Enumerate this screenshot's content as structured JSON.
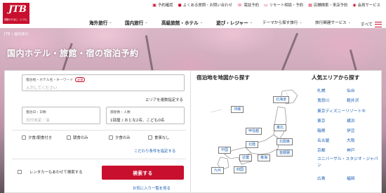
{
  "brand": {
    "logo": "JTB",
    "tagline": "感動のそばに、いつも。"
  },
  "utility": [
    {
      "label": "予約確認",
      "icon": "calendar-icon"
    },
    {
      "label": "よくある質問・お問い合わせ",
      "icon": "question-icon"
    },
    {
      "label": "電話予約",
      "icon": "phone-icon"
    },
    {
      "label": "リモート相談・予約",
      "icon": "monitor-icon"
    },
    {
      "label": "店舗検索・来店予約",
      "icon": "store-icon"
    },
    {
      "label": "会員サービス",
      "icon": "user-icon"
    }
  ],
  "nav": {
    "items": [
      "海外旅行",
      "国内旅行",
      "高級旅館・ホテル",
      "遊び・レジャー",
      "テーマから探す旅行",
      "旅行関連サービス"
    ],
    "menu": "すべて"
  },
  "hero": {
    "label": "JTB ⟩ 国内旅行",
    "title": "国内ホテル・旅館・宿の宿泊予約"
  },
  "search": {
    "keyword": {
      "label": "宿泊地・ホテル名・キーワード",
      "badge": "必須",
      "placeholder": "入力してください"
    },
    "multi_area": "エリアを複数指定する",
    "date": {
      "label": "宿泊日・日数",
      "placeholder": "日付未定・泊"
    },
    "rooms": {
      "label": "部屋数・人数",
      "value": "1部屋 / おとな2名、こども0名"
    },
    "meals": [
      "夕食/朝食付き",
      "朝食のみ",
      "夕食のみ",
      "食事なし"
    ],
    "detail_link": "こだわり条件を指定する",
    "rental_car": "レンタカーもあわせて検索する",
    "submit": "検索する",
    "favorites": "お気に入り一覧を見る"
  },
  "map": {
    "title": "宿泊地を地図から探す",
    "regions": {
      "hokkaido": "北海道",
      "okinawa": "沖縄",
      "tohoku": "東北",
      "koshinetsu": "甲信越",
      "hokuriku": "北陸",
      "kitakanto": "北関東",
      "chugoku": "中国",
      "kinki": "近畿",
      "tokai": "東海",
      "shutoken": "首都圏",
      "kyushu": "九州",
      "shikoku": "四国"
    }
  },
  "popular": {
    "title": "人気エリアから探す",
    "left": [
      "札幌",
      "鬼怒川",
      "東京ディズニーリゾート®",
      "東京",
      "箱根",
      "名古屋",
      "京都",
      "ユニバーサル・スタジオ・ジャパン",
      "広島"
    ],
    "right": [
      "仙台",
      "軽井沢",
      "",
      "横浜",
      "伊豆",
      "大阪",
      "神戸",
      "",
      "福岡"
    ]
  },
  "colors": {
    "brand": "#c8102e",
    "link": "#1a5fb4"
  }
}
